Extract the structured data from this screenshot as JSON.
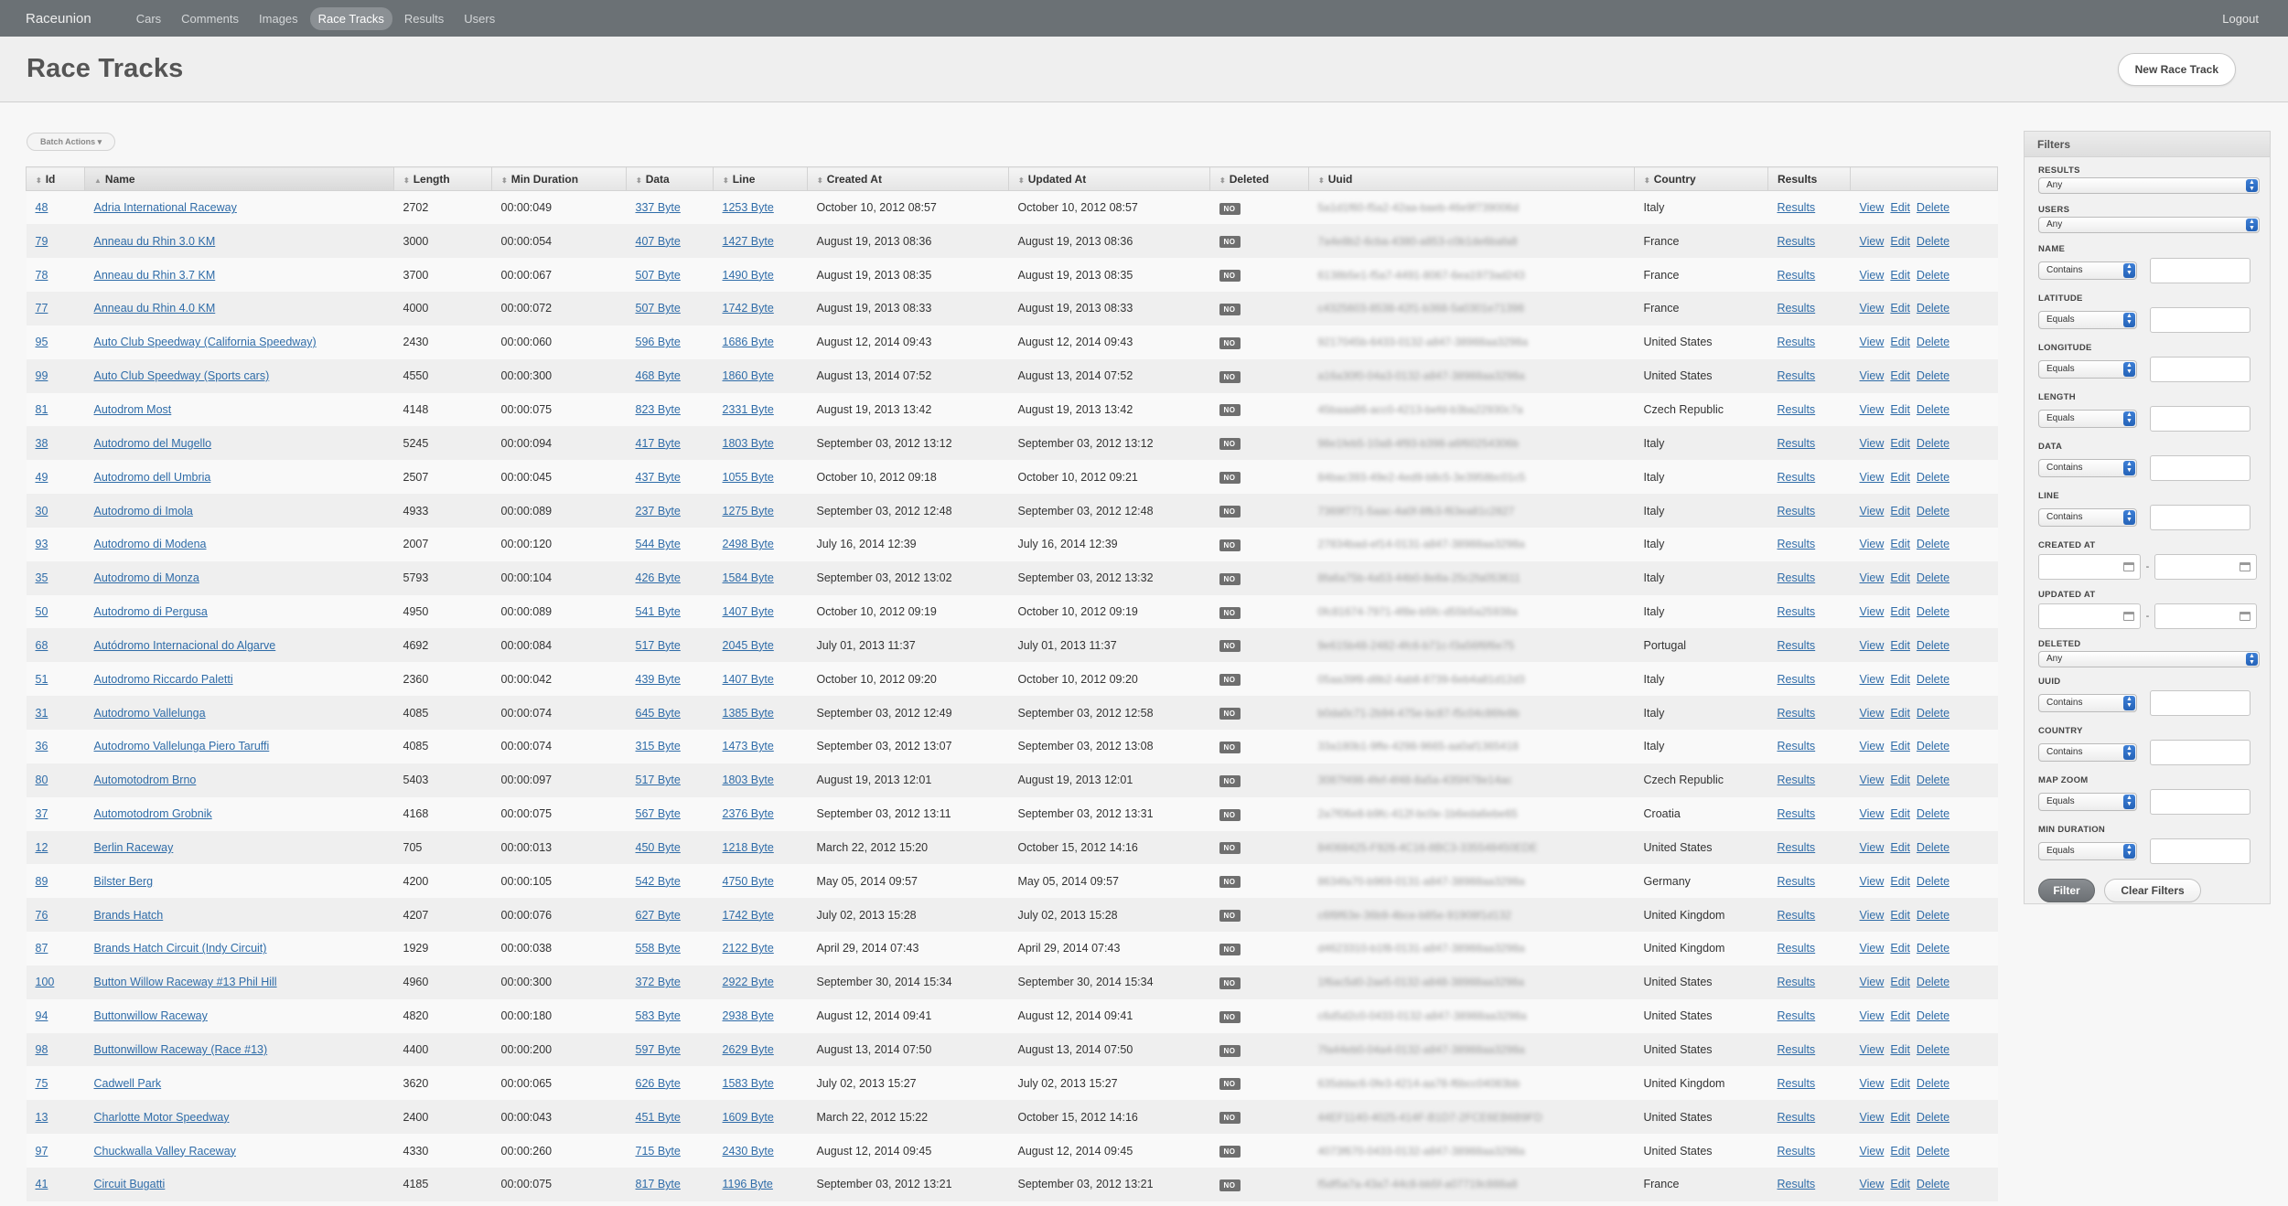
{
  "nav": {
    "brand": "Raceunion",
    "items": [
      {
        "label": "Cars",
        "name": "nav-cars",
        "active": false
      },
      {
        "label": "Comments",
        "name": "nav-comments",
        "active": false
      },
      {
        "label": "Images",
        "name": "nav-images",
        "active": false
      },
      {
        "label": "Race Tracks",
        "name": "nav-race-tracks",
        "active": true
      },
      {
        "label": "Results",
        "name": "nav-results",
        "active": false
      },
      {
        "label": "Users",
        "name": "nav-users",
        "active": false
      }
    ],
    "logout": "Logout"
  },
  "page": {
    "title": "Race Tracks",
    "new_button": "New Race Track",
    "batch_actions": "Batch Actions ▾"
  },
  "table": {
    "columns": [
      "Id",
      "Name",
      "Length",
      "Min Duration",
      "Data",
      "Line",
      "Created At",
      "Updated At",
      "Deleted",
      "Uuid",
      "Country",
      "Results",
      ""
    ],
    "deleted_badge": "NO",
    "results_label": "Results",
    "action_labels": [
      "View",
      "Edit",
      "Delete"
    ],
    "rows": [
      [
        "48",
        "Adria International Raceway",
        "2702",
        "00:00:049",
        "337 Byte",
        "1253 Byte",
        "October 10, 2012 08:57",
        "October 10, 2012 08:57",
        "5a1d1f60-f5a2-42aa-baeb-46e9f739006d",
        "Italy"
      ],
      [
        "79",
        "Anneau du Rhin 3.0 KM",
        "3000",
        "00:00:054",
        "407 Byte",
        "1427 Byte",
        "August 19, 2013 08:36",
        "August 19, 2013 08:36",
        "7a4e8b2-6cba-4380-a853-c0b1de6bafa8",
        "France"
      ],
      [
        "78",
        "Anneau du Rhin 3.7 KM",
        "3700",
        "00:00:067",
        "507 Byte",
        "1490 Byte",
        "August 19, 2013 08:35",
        "August 19, 2013 08:35",
        "6138b5e1-f5a7-4491-8067-6ea1973ad243",
        "France"
      ],
      [
        "77",
        "Anneau du Rhin 4.0 KM",
        "4000",
        "00:00:072",
        "507 Byte",
        "1742 Byte",
        "August 19, 2013 08:33",
        "August 19, 2013 08:33",
        "c4325603-8538-42f1-b368-5a0301e71398",
        "France"
      ],
      [
        "95",
        "Auto Club Speedway (California Speedway)",
        "2430",
        "00:00:060",
        "596 Byte",
        "1686 Byte",
        "August 12, 2014 09:43",
        "August 12, 2014 09:43",
        "9217045b-6433-0132-a847-38988aa3298a",
        "United States"
      ],
      [
        "99",
        "Auto Club Speedway (Sports cars)",
        "4550",
        "00:00:300",
        "468 Byte",
        "1860 Byte",
        "August 13, 2014 07:52",
        "August 13, 2014 07:52",
        "a16a30f0-04a3-0132-a847-38988aa3298a",
        "United States"
      ],
      [
        "81",
        "Autodrom Most",
        "4148",
        "00:00:075",
        "823 Byte",
        "2331 Byte",
        "August 19, 2013 13:42",
        "August 19, 2013 13:42",
        "45baaa86-acc0-4213-befd-b3ba22930c7a",
        "Czech Republic"
      ],
      [
        "38",
        "Autodromo del Mugello",
        "5245",
        "00:00:094",
        "417 Byte",
        "1803 Byte",
        "September 03, 2012 13:12",
        "September 03, 2012 13:12",
        "98e1feb5-10a8-4f93-b398-a6f60254306b",
        "Italy"
      ],
      [
        "49",
        "Autodromo dell Umbria",
        "2507",
        "00:00:045",
        "437 Byte",
        "1055 Byte",
        "October 10, 2012 09:18",
        "October 10, 2012 09:21",
        "84bac393-49e2-4ed9-b8c5-3e3958bc01c5",
        "Italy"
      ],
      [
        "30",
        "Autodromo di Imola",
        "4933",
        "00:00:089",
        "237 Byte",
        "1275 Byte",
        "September 03, 2012 12:48",
        "September 03, 2012 12:48",
        "7369f771-5aac-4a0f-8fb3-f63ea81c2827",
        "Italy"
      ],
      [
        "93",
        "Autodromo di Modena",
        "2007",
        "00:00:120",
        "544 Byte",
        "2498 Byte",
        "July 16, 2014 12:39",
        "July 16, 2014 12:39",
        "27834bad-ef14-0131-a847-38988aa3298a",
        "Italy"
      ],
      [
        "35",
        "Autodromo di Monza",
        "5793",
        "00:00:104",
        "426 Byte",
        "1584 Byte",
        "September 03, 2012 13:02",
        "September 03, 2012 13:32",
        "8fa6a75b-4a53-44b0-8e8a-25c2fa053611",
        "Italy"
      ],
      [
        "50",
        "Autodromo di Pergusa",
        "4950",
        "00:00:089",
        "541 Byte",
        "1407 Byte",
        "October 10, 2012 09:19",
        "October 10, 2012 09:19",
        "0fc81674-7971-4f8e-b5fc-d55b5a25938a",
        "Italy"
      ],
      [
        "68",
        "Autódromo Internacional do Algarve",
        "4692",
        "00:00:084",
        "517 Byte",
        "2045 Byte",
        "July 01, 2013 11:37",
        "July 01, 2013 11:37",
        "9e615b48-2482-4fc6-b71c-f3a56f6f6e75",
        "Portugal"
      ],
      [
        "51",
        "Autodromo Riccardo Paletti",
        "2360",
        "00:00:042",
        "439 Byte",
        "1407 Byte",
        "October 10, 2012 09:20",
        "October 10, 2012 09:20",
        "05aa39f8-d8b2-4ab8-8739-6eb4a81d12d3",
        "Italy"
      ],
      [
        "31",
        "Autodromo Vallelunga",
        "4085",
        "00:00:074",
        "645 Byte",
        "1385 Byte",
        "September 03, 2012 12:49",
        "September 03, 2012 12:58",
        "b0da0c71-2b94-475e-bc87-f5c04c86fe8b",
        "Italy"
      ],
      [
        "36",
        "Autodromo Vallelunga Piero Taruffi",
        "4085",
        "00:00:074",
        "315 Byte",
        "1473 Byte",
        "September 03, 2012 13:07",
        "September 03, 2012 13:08",
        "33a180b1-9ffe-4298-9665-aa0af1365418",
        "Italy"
      ],
      [
        "80",
        "Automotodrom Brno",
        "5403",
        "00:00:097",
        "517 Byte",
        "1803 Byte",
        "August 19, 2013 12:01",
        "August 19, 2013 12:01",
        "3087f498-4fef-4f48-8a5a-435f478e14ac",
        "Czech Republic"
      ],
      [
        "37",
        "Automotodrom Grobnik",
        "4168",
        "00:00:075",
        "567 Byte",
        "2376 Byte",
        "September 03, 2012 13:11",
        "September 03, 2012 13:31",
        "2a7f06e8-b9fc-412f-bc0e-1b6eda6ebe65",
        "Croatia"
      ],
      [
        "12",
        "Berlin Raceway",
        "705",
        "00:00:013",
        "450 Byte",
        "1218 Byte",
        "March 22, 2012 15:20",
        "October 15, 2012 14:16",
        "84068425-F926-4C16-8BC3-335548450EDE",
        "United States"
      ],
      [
        "89",
        "Bilster Berg",
        "4200",
        "00:00:105",
        "542 Byte",
        "4750 Byte",
        "May 05, 2014 09:57",
        "May 05, 2014 09:57",
        "8634fa70-b969-0131-a847-38988aa3298a",
        "Germany"
      ],
      [
        "76",
        "Brands Hatch",
        "4207",
        "00:00:076",
        "627 Byte",
        "1742 Byte",
        "July 02, 2013 15:28",
        "July 02, 2013 15:28",
        "c6f8f63e-36b9-4bce-b85e-91908f1d132",
        "United Kingdom"
      ],
      [
        "87",
        "Brands Hatch Circuit (Indy Circuit)",
        "1929",
        "00:00:038",
        "558 Byte",
        "2122 Byte",
        "April 29, 2014 07:43",
        "April 29, 2014 07:43",
        "d4623310-b1f8-0131-a847-38988aa3298a",
        "United Kingdom"
      ],
      [
        "100",
        "Button Willow Raceway #13 Phil Hill",
        "4960",
        "00:00:300",
        "372 Byte",
        "2922 Byte",
        "September 30, 2014 15:34",
        "September 30, 2014 15:34",
        "1f6ac5d0-2ae5-0132-a848-38988aa3298a",
        "United States"
      ],
      [
        "94",
        "Buttonwillow Raceway",
        "4820",
        "00:00:180",
        "583 Byte",
        "2938 Byte",
        "August 12, 2014 09:41",
        "August 12, 2014 09:41",
        "c6d5d2c0-0433-0132-a847-38988aa3298a",
        "United States"
      ],
      [
        "98",
        "Buttonwillow Raceway (Race #13)",
        "4400",
        "00:00:200",
        "597 Byte",
        "2629 Byte",
        "August 13, 2014 07:50",
        "August 13, 2014 07:50",
        "7fa44eb0-04a4-0132-a847-38988aa3298a",
        "United States"
      ],
      [
        "75",
        "Cadwell Park",
        "3620",
        "00:00:065",
        "626 Byte",
        "1583 Byte",
        "July 02, 2013 15:27",
        "July 02, 2013 15:27",
        "635ddac6-0fe3-4214-aa78-f6bcc04083bb",
        "United Kingdom"
      ],
      [
        "13",
        "Charlotte Motor Speedway",
        "2400",
        "00:00:043",
        "451 Byte",
        "1609 Byte",
        "March 22, 2012 15:22",
        "October 15, 2012 14:16",
        "44EF1140-4025-414F-B1D7-2FCE6EB6B9FD",
        "United States"
      ],
      [
        "97",
        "Chuckwalla Valley Raceway",
        "4330",
        "00:00:260",
        "715 Byte",
        "2430 Byte",
        "August 12, 2014 09:45",
        "August 12, 2014 09:45",
        "4073f670-0433-0132-a847-38988aa3298a",
        "United States"
      ],
      [
        "41",
        "Circuit Bugatti",
        "4185",
        "00:00:075",
        "817 Byte",
        "1196 Byte",
        "September 03, 2012 13:21",
        "September 03, 2012 13:21",
        "f5df5a7a-43a7-44c8-bb5f-a07719c888a8",
        "France"
      ]
    ]
  },
  "filters": {
    "title": "Filters",
    "results": {
      "label": "RESULTS",
      "value": "Any"
    },
    "users": {
      "label": "USERS",
      "value": "Any"
    },
    "name": {
      "label": "NAME",
      "op": "Contains"
    },
    "latitude": {
      "label": "LATITUDE",
      "op": "Equals"
    },
    "longitude": {
      "label": "LONGITUDE",
      "op": "Equals"
    },
    "length": {
      "label": "LENGTH",
      "op": "Equals"
    },
    "data": {
      "label": "DATA",
      "op": "Contains"
    },
    "line": {
      "label": "LINE",
      "op": "Contains"
    },
    "created_at": {
      "label": "CREATED AT"
    },
    "updated_at": {
      "label": "UPDATED AT"
    },
    "deleted": {
      "label": "DELETED",
      "value": "Any"
    },
    "uuid": {
      "label": "UUID",
      "op": "Contains"
    },
    "country": {
      "label": "COUNTRY",
      "op": "Contains"
    },
    "map_zoom": {
      "label": "MAP ZOOM",
      "op": "Equals"
    },
    "min_duration": {
      "label": "MIN DURATION",
      "op": "Equals"
    },
    "filter_button": "Filter",
    "clear_button": "Clear Filters"
  }
}
